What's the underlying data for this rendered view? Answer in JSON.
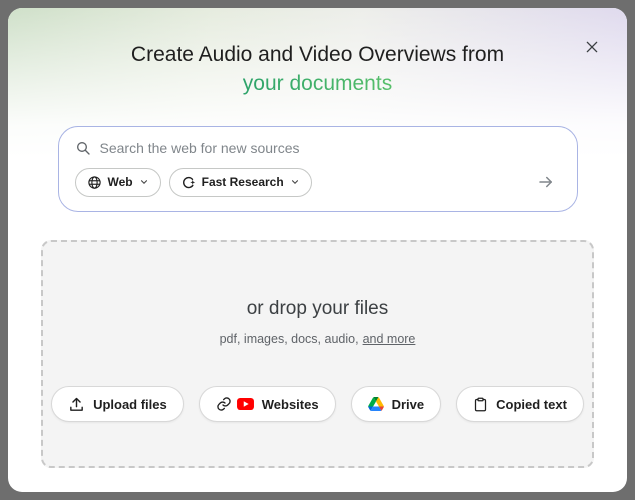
{
  "dialog": {
    "title_line1": "Create Audio and Video Overviews from",
    "title_line2": "your documents"
  },
  "search": {
    "placeholder": "Search the web for new sources",
    "source_chip": {
      "label": "Web",
      "icon": "globe-icon"
    },
    "mode_chip": {
      "label": "Fast Research",
      "icon": "sparkle-icon"
    },
    "submit": {
      "icon": "arrow-right-icon"
    }
  },
  "dropzone": {
    "heading": "or drop your files",
    "file_types": "pdf, images, docs, audio,",
    "more_link": "and more",
    "buttons": [
      {
        "label": "Upload files",
        "icon": "upload-icon"
      },
      {
        "label": "Websites",
        "icon": "link-icon,youtube-icon"
      },
      {
        "label": "Drive",
        "icon": "drive-icon"
      },
      {
        "label": "Copied text",
        "icon": "clipboard-icon"
      }
    ]
  },
  "colors": {
    "accent_gradient_start": "#2da36a",
    "accent_gradient_end": "#57bf6a",
    "search_border": "#a9b4e4",
    "youtube_red": "#ff0000",
    "drive_blue": "#2684fc",
    "drive_green": "#00ac47",
    "drive_yellow": "#ffba00"
  }
}
